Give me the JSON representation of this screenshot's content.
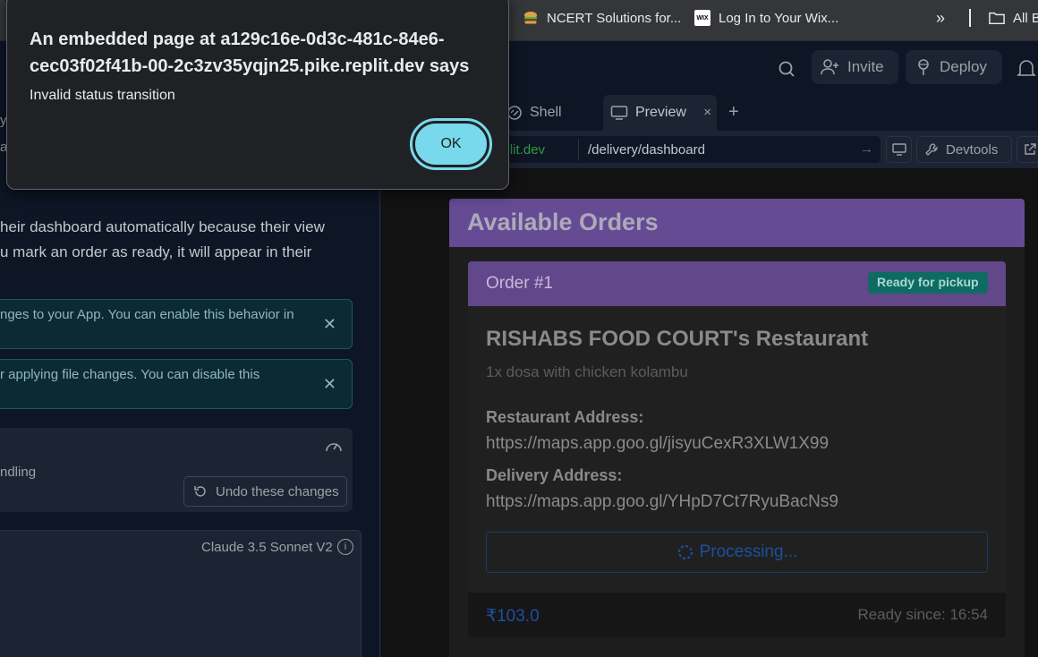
{
  "bookmarks": {
    "items": [
      {
        "label": "NCERT Solutions for...",
        "icon": "burger-favicon-icon"
      },
      {
        "label": "Log In to Your Wix...",
        "icon": "wix-favicon-icon",
        "icon_text": "WIX"
      }
    ],
    "more": "»",
    "all_label": "All B"
  },
  "header": {
    "invite_label": "Invite",
    "deploy_label": "Deploy"
  },
  "left_panel": {
    "edge_text_1": "y",
    "edge_text_2": "au",
    "message_line_1": "heir dashboard automatically because their view",
    "message_line_2": "u mark an order as ready, it will appear in their",
    "notice_1": "nges to your App. You can enable this behavior in",
    "notice_2": "r applying file changes. You can disable this",
    "checkpoint_text": "ndling",
    "undo_label": "Undo these changes",
    "model_label": "Claude 3.5 Sonnet V2",
    "model_info": "i"
  },
  "tabs": {
    "shell_label": "Shell",
    "preview_label": "Preview",
    "close": "×",
    "add": "+"
  },
  "urlbar": {
    "domain": ".replit.dev",
    "path": "/delivery/dashboard",
    "go": "→",
    "devtools_label": "Devtools"
  },
  "app": {
    "heading": "Available Orders",
    "order": {
      "title": "Order #1",
      "status": "Ready for pickup",
      "restaurant": "RISHABS FOOD COURT's Restaurant",
      "items": "1x dosa with chicken kolambu",
      "restaurant_address_label": "Restaurant Address:",
      "restaurant_address": "https://maps.app.goo.gl/jisyuCexR3XLW1X99",
      "delivery_address_label": "Delivery Address:",
      "delivery_address": "https://maps.app.goo.gl/YHpD7Ct7RyuBacNs9",
      "button_label": "Processing...",
      "price": "₹103.0",
      "ready_since": "Ready since: 16:54"
    }
  },
  "dialog": {
    "title": "An embedded page at a129c16e-0d3c-481c-84e6-cec03f02f41b-00-2c3zv35yqjn25.pike.replit.dev says",
    "message": "Invalid status transition",
    "ok_label": "OK"
  },
  "colors": {
    "purple_header": "#7a5ab4",
    "ready_badge": "#0f6b62",
    "dialog_button": "#78d9ec",
    "url_domain": "#2f9e44"
  }
}
